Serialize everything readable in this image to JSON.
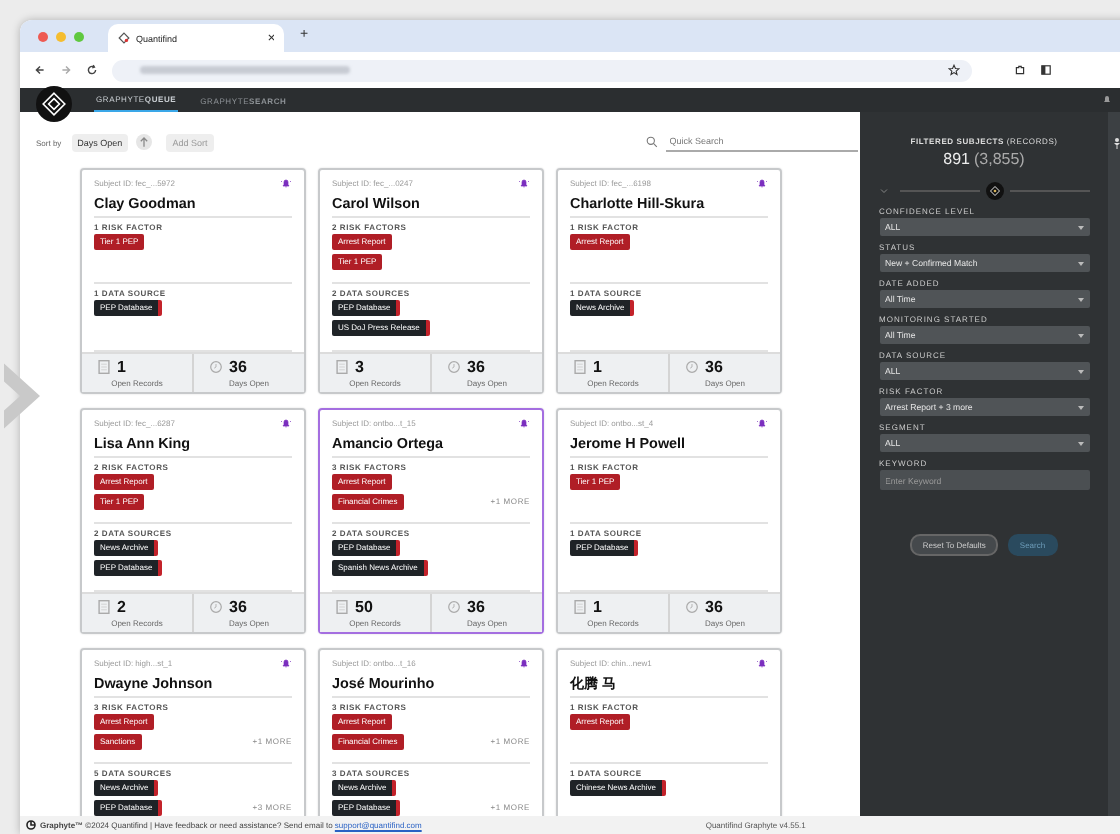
{
  "browser": {
    "tab_title": "Quantifind",
    "new_tab": "+"
  },
  "nav": {
    "tabs": [
      {
        "label": "GRAPHYTE**QUEUE**",
        "selected": true
      },
      {
        "label": "GRAPHYTE**SEARCH**",
        "selected": false
      }
    ]
  },
  "sort": {
    "label": "Sort by",
    "field": "Days Open",
    "add": "Add Sort"
  },
  "search": {
    "placeholder": "Quick Search"
  },
  "cards": [
    {
      "subject_id": "Subject ID: fec_...5972",
      "name": "Clay Goodman",
      "selected": false,
      "risk_label": "1 RISK FACTOR",
      "risks": [
        "Tier 1 PEP"
      ],
      "sources_label": "1 DATA SOURCE",
      "sources": [
        "PEP Database"
      ],
      "open_records": "1",
      "open_records_label": "Open Records",
      "days_open": "36",
      "days_open_label": "Days Open"
    },
    {
      "subject_id": "Subject ID: fec_...0247",
      "name": "Carol Wilson",
      "selected": false,
      "risk_label": "2 RISK FACTORS",
      "risks": [
        "Arrest Report",
        "Tier 1 PEP"
      ],
      "sources_label": "2 DATA SOURCES",
      "sources": [
        "PEP Database",
        "US DoJ Press Release"
      ],
      "open_records": "3",
      "open_records_label": "Open Records",
      "days_open": "36",
      "days_open_label": "Days Open"
    },
    {
      "subject_id": "Subject ID: fec_...6198",
      "name": "Charlotte Hill-Skura",
      "selected": false,
      "risk_label": "1 RISK FACTOR",
      "risks": [
        "Arrest Report"
      ],
      "sources_label": "1 DATA SOURCE",
      "sources": [
        "News Archive"
      ],
      "open_records": "1",
      "open_records_label": "Open Records",
      "days_open": "36",
      "days_open_label": "Days Open"
    },
    {
      "subject_id": "Subject ID: fec_...6287",
      "name": "Lisa Ann King",
      "selected": false,
      "risk_label": "2 RISK FACTORS",
      "risks": [
        "Arrest Report",
        "Tier 1 PEP"
      ],
      "sources_label": "2 DATA SOURCES",
      "sources": [
        "News Archive",
        "PEP Database"
      ],
      "open_records": "2",
      "open_records_label": "Open Records",
      "days_open": "36",
      "days_open_label": "Days Open"
    },
    {
      "subject_id": "Subject ID: ontbo...t_15",
      "name": "Amancio Ortega",
      "selected": true,
      "risk_label": "3 RISK FACTORS",
      "risks": [
        "Arrest Report",
        "Financial Crimes"
      ],
      "risks_more": "+1 MORE",
      "sources_label": "2 DATA SOURCES",
      "sources": [
        "PEP Database",
        "Spanish News Archive"
      ],
      "open_records": "50",
      "open_records_label": "Open Records",
      "days_open": "36",
      "days_open_label": "Days Open"
    },
    {
      "subject_id": "Subject ID: ontbo...st_4",
      "name": "Jerome H Powell",
      "selected": false,
      "risk_label": "1 RISK FACTOR",
      "risks": [
        "Tier 1 PEP"
      ],
      "sources_label": "1 DATA SOURCE",
      "sources": [
        "PEP Database"
      ],
      "open_records": "1",
      "open_records_label": "Open Records",
      "days_open": "36",
      "days_open_label": "Days Open"
    },
    {
      "subject_id": "Subject ID: high...st_1",
      "name": "Dwayne Johnson",
      "selected": false,
      "risk_label": "3 RISK FACTORS",
      "risks": [
        "Arrest Report",
        "Sanctions"
      ],
      "risks_more": "+1 MORE",
      "sources_label": "5 DATA SOURCES",
      "sources": [
        "News Archive",
        "PEP Database"
      ],
      "sources_more": "+3 MORE"
    },
    {
      "subject_id": "Subject ID: ontbo...t_16",
      "name": "José Mourinho",
      "selected": false,
      "risk_label": "3 RISK FACTORS",
      "risks": [
        "Arrest Report",
        "Financial Crimes"
      ],
      "risks_more": "+1 MORE",
      "sources_label": "3 DATA SOURCES",
      "sources": [
        "News Archive",
        "PEP Database"
      ],
      "sources_more": "+1 MORE"
    },
    {
      "subject_id": "Subject ID: chin...new1",
      "name": "化腾 马",
      "selected": false,
      "risk_label": "1 RISK FACTOR",
      "risks": [
        "Arrest Report"
      ],
      "sources_label": "1 DATA SOURCE",
      "sources": [
        "Chinese News Archive"
      ]
    }
  ],
  "sidebar": {
    "title": "**FILTERED SUBJECTS** (RECORDS)",
    "count": "891",
    "records": "(3,855)",
    "filters": [
      {
        "label": "CONFIDENCE LEVEL",
        "value": "ALL"
      },
      {
        "label": "STATUS",
        "value": "New + Confirmed Match"
      },
      {
        "label": "DATE ADDED",
        "value": "All Time"
      },
      {
        "label": "MONITORING STARTED",
        "value": "All Time"
      },
      {
        "label": "DATA SOURCE",
        "value": "ALL"
      },
      {
        "label": "RISK FACTOR",
        "value": "Arrest Report + 3 more"
      },
      {
        "label": "SEGMENT",
        "value": "ALL"
      }
    ],
    "keyword": {
      "label": "KEYWORD",
      "placeholder": "Enter Keyword"
    },
    "reset": "Reset To Defaults",
    "search": "Search"
  },
  "footer": {
    "text": "**Graphyte™** ©2024 Quantifind | Have feedback or need assistance? Send email to",
    "email": "support@quantifind.com",
    "version": "Quantifind Graphyte v4.55.1"
  }
}
